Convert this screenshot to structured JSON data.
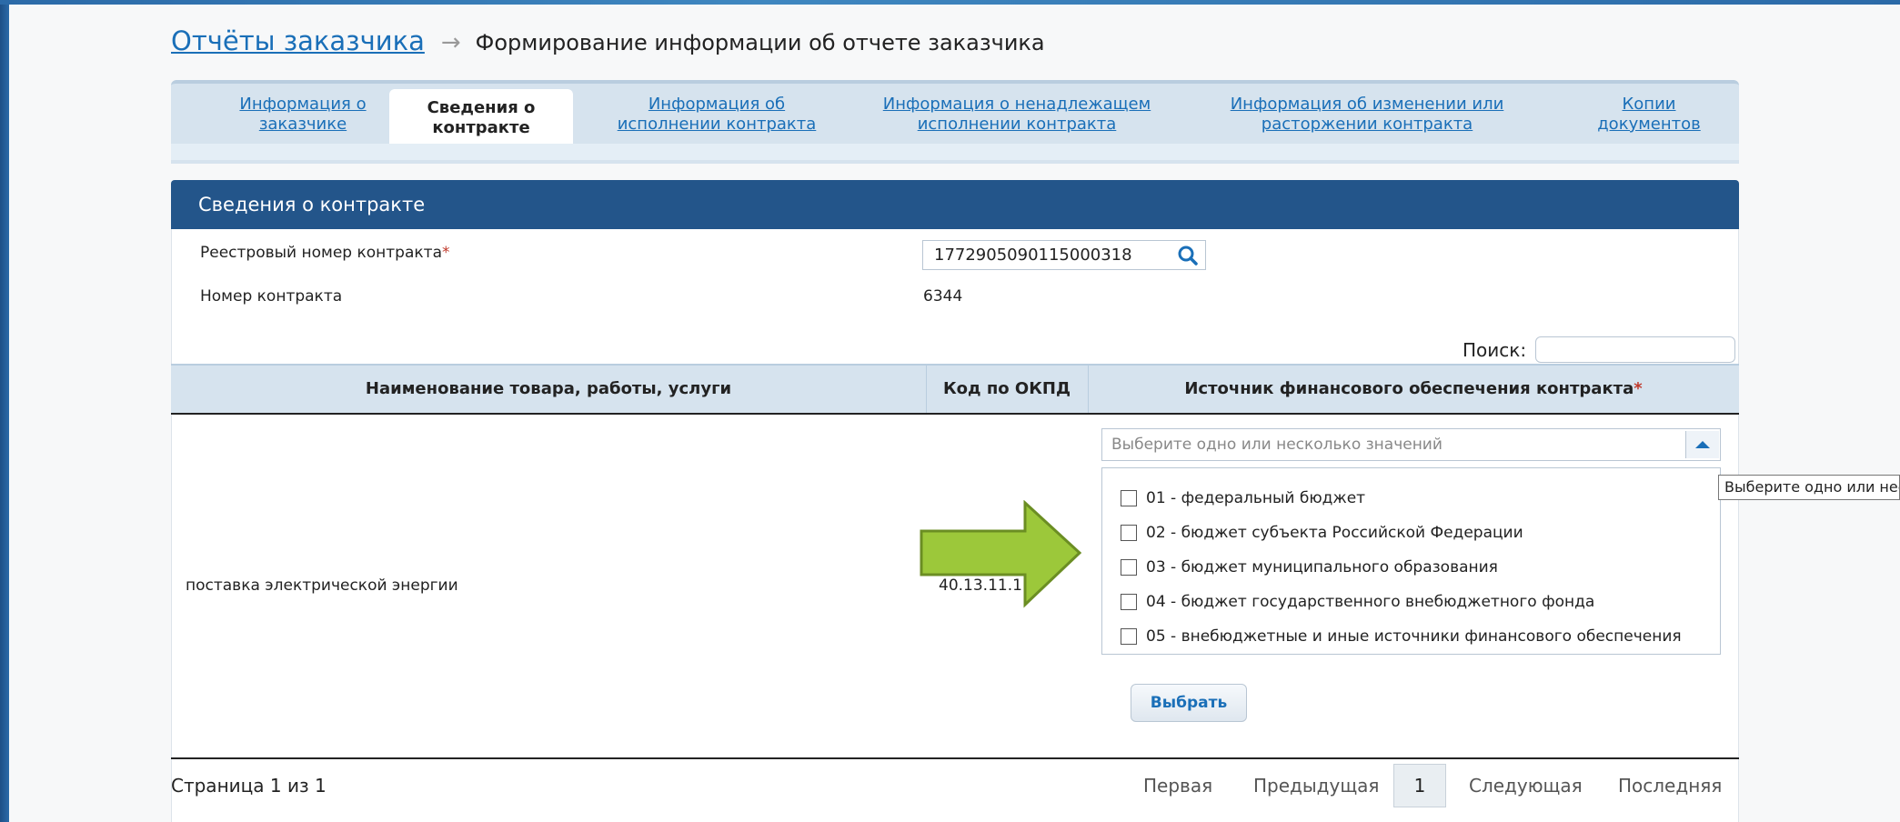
{
  "breadcrumb": {
    "parent": "Отчёты заказчика",
    "separator": "→",
    "current": "Формирование информации об отчете заказчика"
  },
  "tabs": [
    {
      "label_line1": "Информация о",
      "label_line2": "заказчике",
      "active": false
    },
    {
      "label_line1": "Сведения о",
      "label_line2": "контракте",
      "active": true
    },
    {
      "label_line1": "Информация об",
      "label_line2": "исполнении контракта",
      "active": false
    },
    {
      "label_line1": "Информация о ненадлежащем",
      "label_line2": "исполнении контракта",
      "active": false
    },
    {
      "label_line1": "Информация об изменении или",
      "label_line2": "расторжении контракта",
      "active": false
    },
    {
      "label_line1": "Копии",
      "label_line2": "документов",
      "active": false
    }
  ],
  "panel": {
    "title": "Сведения о контракте",
    "reg_number_label": "Реестровый номер контракта",
    "required_mark": "*",
    "reg_number_value": "1772905090115000318",
    "contract_number_label": "Номер контракта",
    "contract_number_value": "6344",
    "search_label": "Поиск:",
    "search_value": ""
  },
  "table": {
    "columns": [
      "Наименование товара, работы, услуги",
      "Код по ОКПД",
      "Источник финансового обеспечения контракта"
    ],
    "required_mark": "*",
    "rows": [
      {
        "name": "поставка электрической энергии",
        "code": "40.13.11.11"
      }
    ]
  },
  "dropdown": {
    "placeholder": "Выберите одно или несколько значений",
    "options": [
      "01 - федеральный бюджет",
      "02 - бюджет субъекта Российской Федерации",
      "03 - бюджет муниципального образования",
      "04 - бюджет государственного внебюджетного фонда",
      "05 - внебюджетные и иные источники финансового обеспечения"
    ],
    "tooltip": "Выберите одно или несколько значений",
    "select_button": "Выбрать"
  },
  "pagination": {
    "info": "Страница 1 из 1",
    "first": "Первая",
    "prev": "Предыдущая",
    "current": "1",
    "next": "Следующая",
    "last": "Последняя"
  },
  "colors": {
    "accent": "#1a6fb8",
    "header_bg": "#23558a",
    "arrow_fill": "#9cc83a",
    "arrow_stroke": "#6b8e23"
  },
  "icons": {
    "search": "search-icon",
    "dropdown": "triangle-up-icon",
    "pointer": "green-arrow-icon"
  }
}
